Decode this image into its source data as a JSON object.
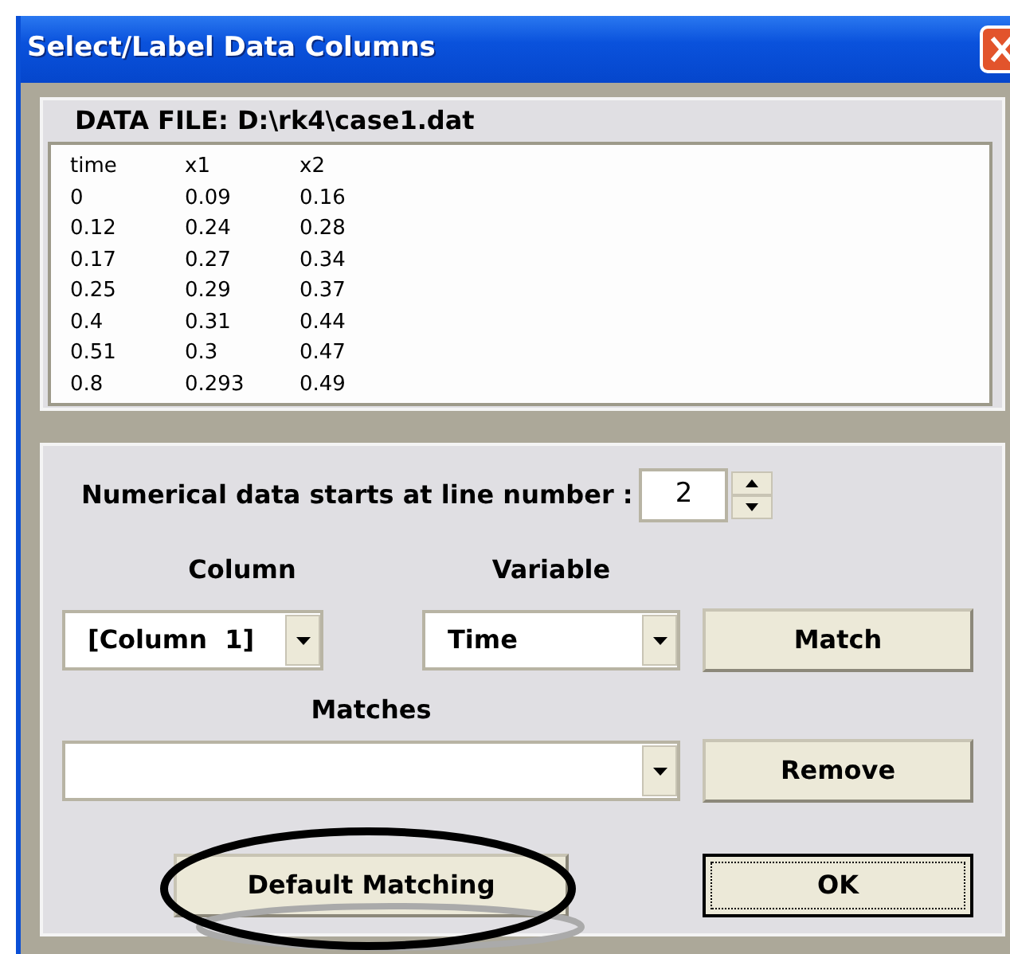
{
  "window": {
    "title": "Select/Label Data Columns"
  },
  "data_file": {
    "label": "DATA FILE: D:\\rk4\\case1.dat",
    "lines": [
      [
        "time",
        "x1",
        "x2"
      ],
      [
        "0",
        "0.09",
        "0.16"
      ],
      [
        "0.12",
        "0.24",
        "0.28"
      ],
      [
        "0.17",
        "0.27",
        "0.34"
      ],
      [
        "0.25",
        "0.29",
        "0.37"
      ],
      [
        "0.4",
        "0.31",
        "0.44"
      ],
      [
        "0.51",
        "0.3",
        "0.47"
      ],
      [
        "0.8",
        "0.293",
        "0.49"
      ]
    ]
  },
  "start_line": {
    "label": "Numerical data starts at line number :",
    "value": "2"
  },
  "column": {
    "label": "Column",
    "value": "[Column  1]"
  },
  "variable": {
    "label": "Variable",
    "value": "Time"
  },
  "match_button": {
    "label": "Match"
  },
  "matches": {
    "label": "Matches"
  },
  "remove_button": {
    "label": "Remove"
  },
  "default_matching_button": {
    "label": "Default Matching",
    "circled": true
  },
  "ok_button": {
    "label": "OK",
    "default": true
  }
}
